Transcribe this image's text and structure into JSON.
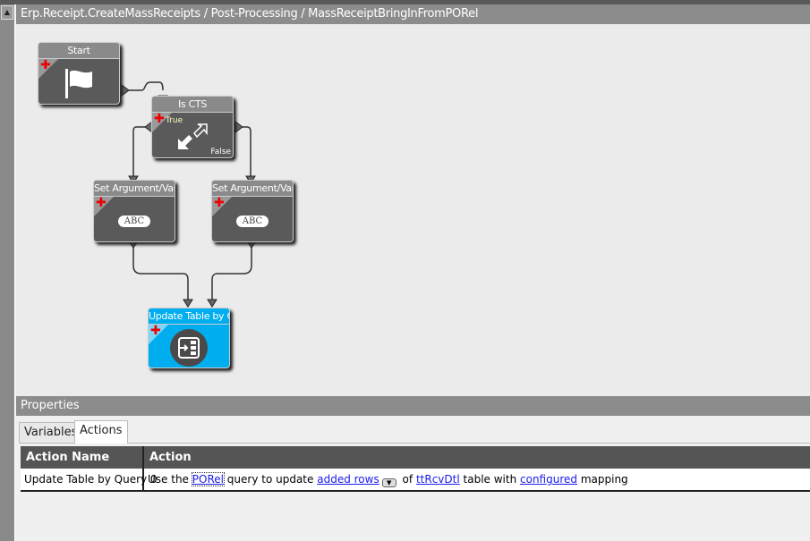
{
  "title": "Erp.Receipt.CreateMassReceipts / Post-Processing / MassReceiptBringInFromPORel",
  "colors": {
    "node": "#5a5a5a",
    "selected_node": "#00aeef",
    "header": "#8c8c8c",
    "link": "#1a1aee"
  },
  "nodes": {
    "start": {
      "label": "Start",
      "icon": "flag-icon"
    },
    "condition": {
      "label": "Is CTS",
      "true_label": "True",
      "false_label": "False",
      "icon": "condition-arrows-icon"
    },
    "set_arg_1": {
      "label": "Set Argument/Vari",
      "icon_text": "ABC"
    },
    "set_arg_2": {
      "label": "Set Argument/Vari",
      "icon_text": "ABC"
    },
    "update_table": {
      "label": "Update Table by Q",
      "icon": "update-table-icon",
      "selected": true
    }
  },
  "properties": {
    "title": "Properties",
    "tabs": [
      {
        "label": "Variables",
        "active": false
      },
      {
        "label": "Actions",
        "active": true
      }
    ],
    "table": {
      "columns": [
        "Action Name",
        "Action"
      ],
      "rows": [
        {
          "name": "Update Table by Query 0",
          "action": {
            "t1": "Use the",
            "link1": "PORel",
            "t2": "query to update",
            "link2": "added rows",
            "t3": "of",
            "link3": "ttRcvDtl",
            "t4": "table with",
            "link4": "configured",
            "t5": "mapping"
          }
        }
      ]
    }
  }
}
